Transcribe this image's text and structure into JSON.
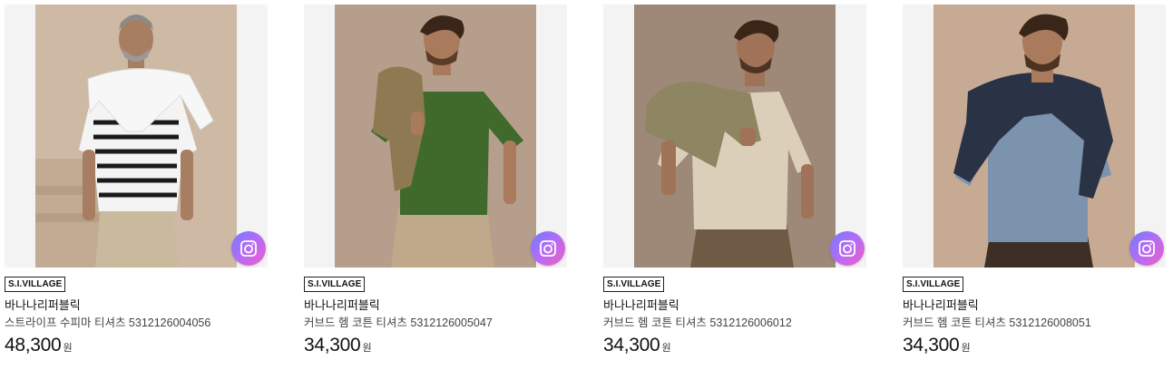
{
  "products": [
    {
      "badge": "S.I.VILLAGE",
      "brand": "바나나리퍼블릭",
      "name": "스트라이프 수피마 티셔츠 5312126004056",
      "price": "48,300",
      "currency": "원",
      "image": "man-striped-tee-white-sweater",
      "background_color": "#cdb9a4",
      "shirt_color": "#f4f4f4",
      "pants_color": "#c9b99d"
    },
    {
      "badge": "S.I.VILLAGE",
      "brand": "바나나리퍼블릭",
      "name": "커브드 헴 코튼 티셔츠 5312126005047",
      "price": "34,300",
      "currency": "원",
      "image": "man-green-tee-khaki-jacket",
      "background_color": "#b69e8c",
      "shirt_color": "#3f6a2c",
      "pants_color": "#bfa98a"
    },
    {
      "badge": "S.I.VILLAGE",
      "brand": "바나나리퍼블릭",
      "name": "커브드 헴 코튼 티셔츠 5312126006012",
      "price": "34,300",
      "currency": "원",
      "image": "man-oatmeal-tee-olive-jacket",
      "background_color": "#9e8878",
      "shirt_color": "#dccfb9",
      "pants_color": "#6e5a45"
    },
    {
      "badge": "S.I.VILLAGE",
      "brand": "바나나리퍼블릭",
      "name": "커브드 헴 코튼 티셔츠 5312126008051",
      "price": "34,300",
      "currency": "원",
      "image": "man-blue-tee-navy-sweater",
      "background_color": "#c7aa93",
      "shirt_color": "#7c93ad",
      "pants_color": "#3d2e26"
    }
  ],
  "lens_icon": "camera-search-icon",
  "lens_gradient": [
    "#6f7bff",
    "#b56cf5",
    "#f05ec7"
  ]
}
